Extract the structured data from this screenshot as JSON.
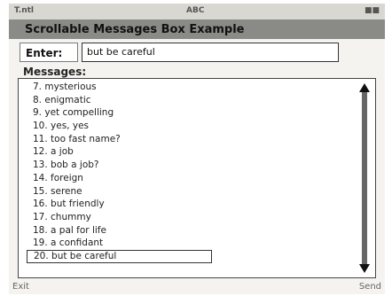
{
  "status_bar": {
    "left": "T.ntl",
    "center": "ABC",
    "right": "■■"
  },
  "app": {
    "title": "Scrollable Messages Box Example"
  },
  "enter": {
    "label": "Enter:",
    "value": "but be careful"
  },
  "messages": {
    "label": "Messages:",
    "items": [
      "7. mysterious",
      "8. enigmatic",
      "9. yet compelling",
      "10. yes, yes",
      "11. too fast name?",
      "12. a job",
      "13. bob a job?",
      "14. foreign",
      "15. serene",
      "16. but friendly",
      "17. chummy",
      "18. a pal for life",
      "19. a confidant",
      "20. but be careful"
    ]
  },
  "soft_keys": {
    "left": "Exit",
    "right": "Send"
  }
}
